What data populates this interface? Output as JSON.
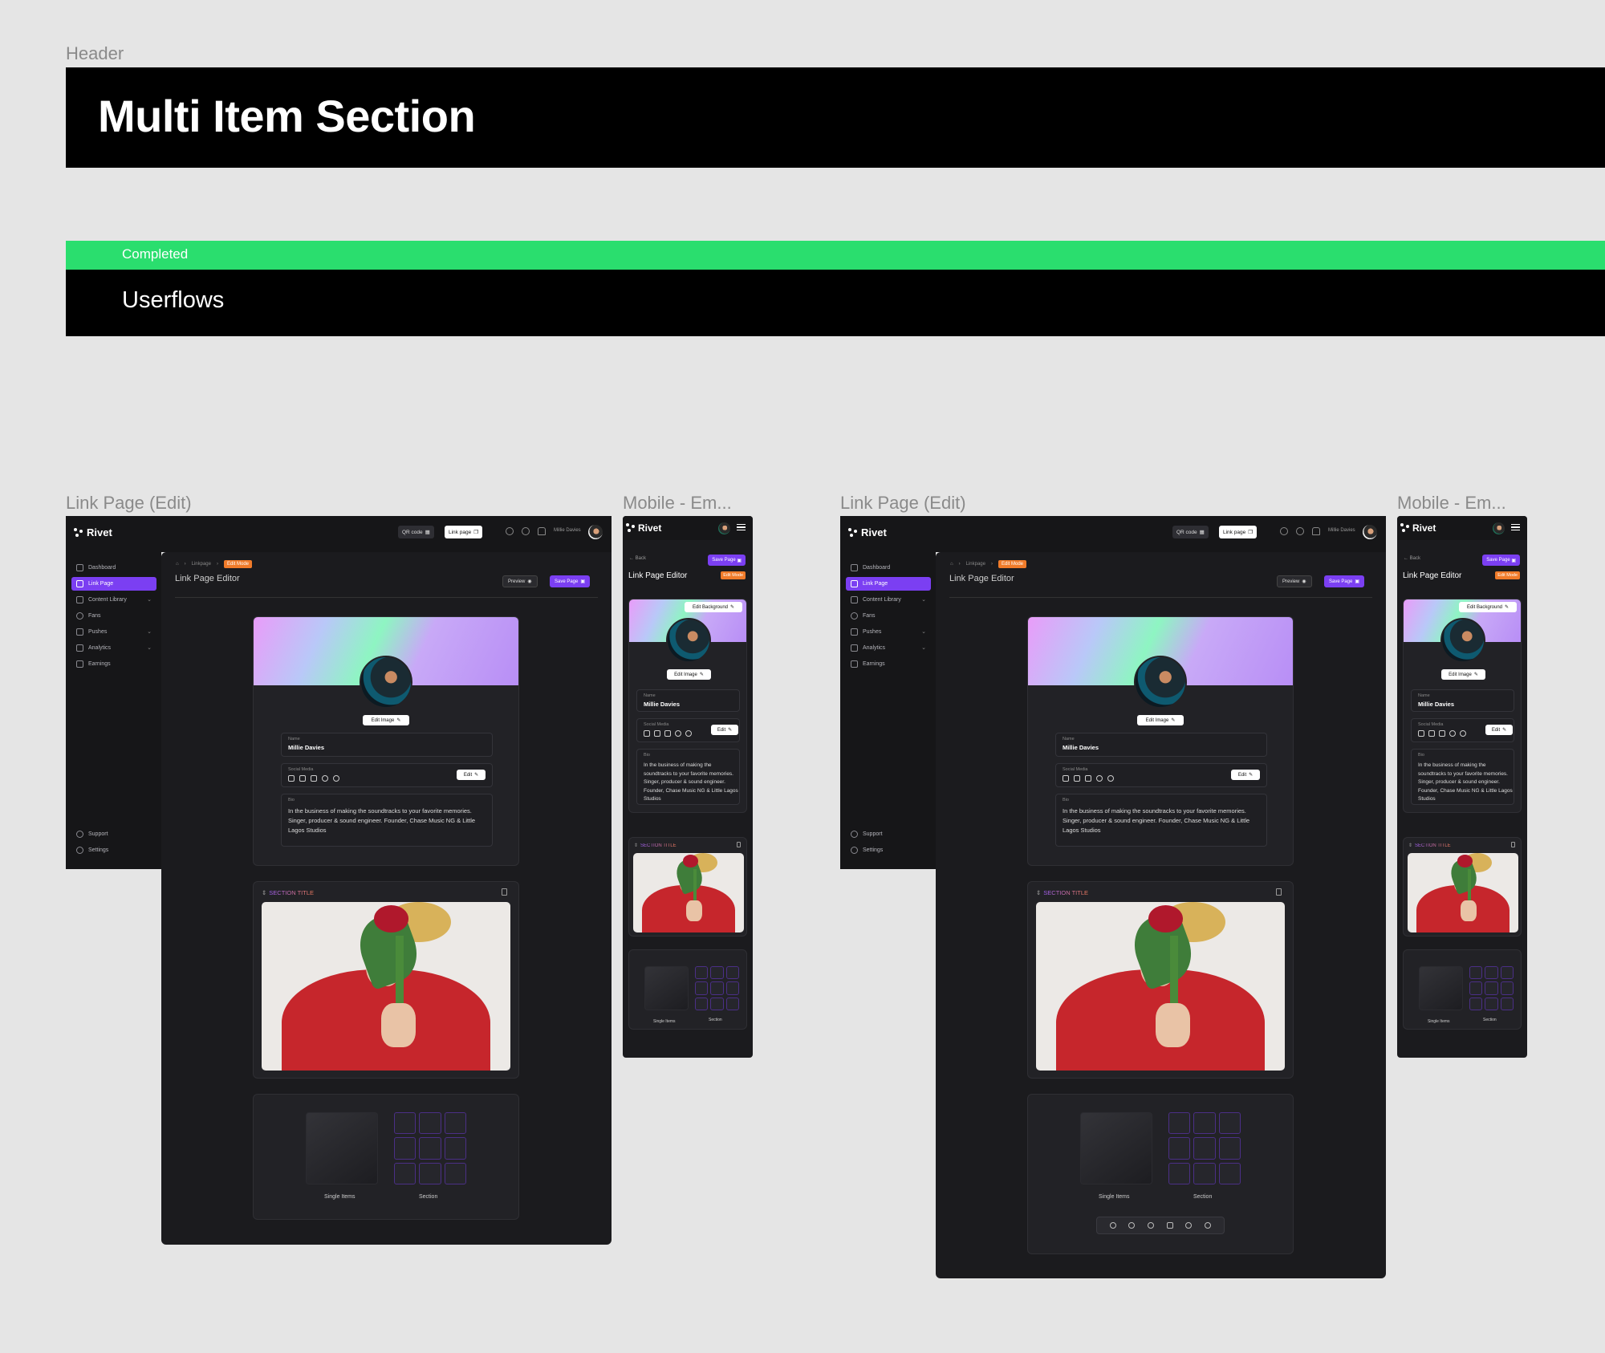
{
  "header": {
    "label": "Header",
    "title": "Multi Item Section"
  },
  "status": {
    "label": "Completed",
    "color": "#2ade6e"
  },
  "section": {
    "title": "Userflows"
  },
  "frames": {
    "desktop_a": "Link Page (Edit)",
    "mobile_a": "Mobile - Em...",
    "desktop_b": "Link Page (Edit)",
    "mobile_b": "Mobile - Em..."
  },
  "app": {
    "brand": "Rivet",
    "topbar": {
      "qr_code": "QR code",
      "link_page": "Link page",
      "user_name": "Millie Davies"
    },
    "nav": [
      "Dashboard",
      "Link Page",
      "Content Library",
      "Fans",
      "Pushes",
      "Analytics",
      "Earnings"
    ],
    "nav_bottom": [
      "Support",
      "Settings"
    ],
    "breadcrumb": {
      "root": "Linkpage",
      "mode": "Edit Mode"
    },
    "page_title": "Link Page Editor",
    "preview": "Preview",
    "save_page": "Save Page",
    "edit_image": "Edit Image",
    "edit_background": "Edit Background",
    "name_label": "Name",
    "name_value": "Millie Davies",
    "social_label": "Social Media",
    "edit": "Edit",
    "bio_label": "Bio",
    "bio_value": "In the business of making the soundtracks to your favorite memories. Singer, producer & sound engineer. Founder, Chase Music NG & Little Lagos Studios",
    "section_title": "SECTION TITLE",
    "single_items": "Single Items",
    "section_label": "Section",
    "back": "Back"
  },
  "colors": {
    "accent": "#7b3ff2",
    "edit_mode": "#f07b2a",
    "bg_dark": "#1b1b1e"
  }
}
